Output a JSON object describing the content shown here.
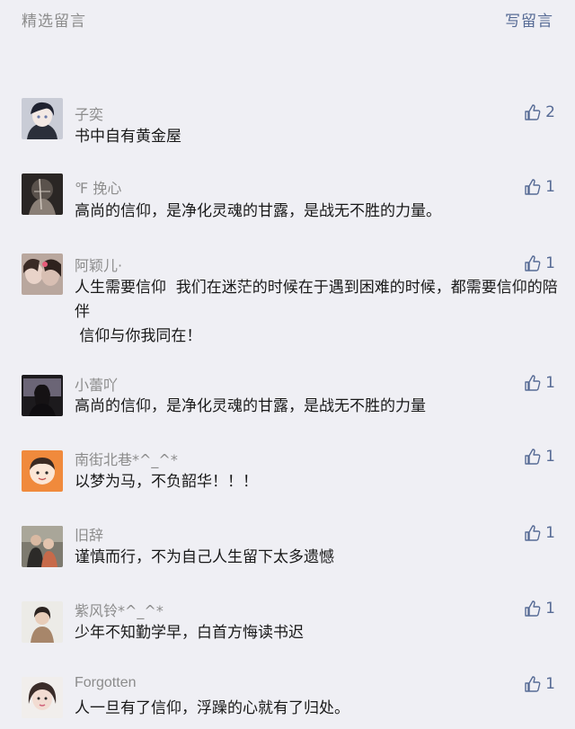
{
  "header": {
    "title": "精选留言",
    "write_label": "写留言"
  },
  "colors": {
    "link": "#576b95",
    "muted": "#8c8c8c",
    "background": "#efeff4"
  },
  "comments": [
    {
      "nick": "子奕",
      "content": "书中自有黄金屋",
      "likes": "2",
      "avatar": "anime-boy-avatar"
    },
    {
      "nick": "℉ 挽心",
      "content": "高尚的信仰，是净化灵魂的甘露，是战无不胜的力量。",
      "likes": "1",
      "avatar": "dark-figure-avatar"
    },
    {
      "nick": "阿颖儿·",
      "content": "人生需要信仰  我们在迷茫的时候在于遇到困难的时候，都需要信仰的陪伴\n 信仰与你我同在！",
      "likes": "1",
      "avatar": "girl-photo-avatar"
    },
    {
      "nick": "小蕾吖",
      "content": "高尚的信仰，是净化灵魂的甘露，是战无不胜的力量",
      "likes": "1",
      "avatar": "dark-room-avatar"
    },
    {
      "nick": "南街北巷*^_^*",
      "content": "以梦为马，不负韶华！！！",
      "likes": "1",
      "avatar": "cartoon-kid-avatar"
    },
    {
      "nick": "旧辞",
      "content": "谨慎而行，不为自己人生留下太多遗憾",
      "likes": "1",
      "avatar": "couple-photo-avatar"
    },
    {
      "nick": "紫风铃*^_^*",
      "content": "少年不知勤学早，白首方悔读书迟",
      "likes": "1",
      "avatar": "girl-light-avatar"
    },
    {
      "nick": "Forgotten",
      "content": "人一旦有了信仰，浮躁的心就有了归处。",
      "likes": "1",
      "avatar": "girl-selfie-avatar"
    }
  ]
}
